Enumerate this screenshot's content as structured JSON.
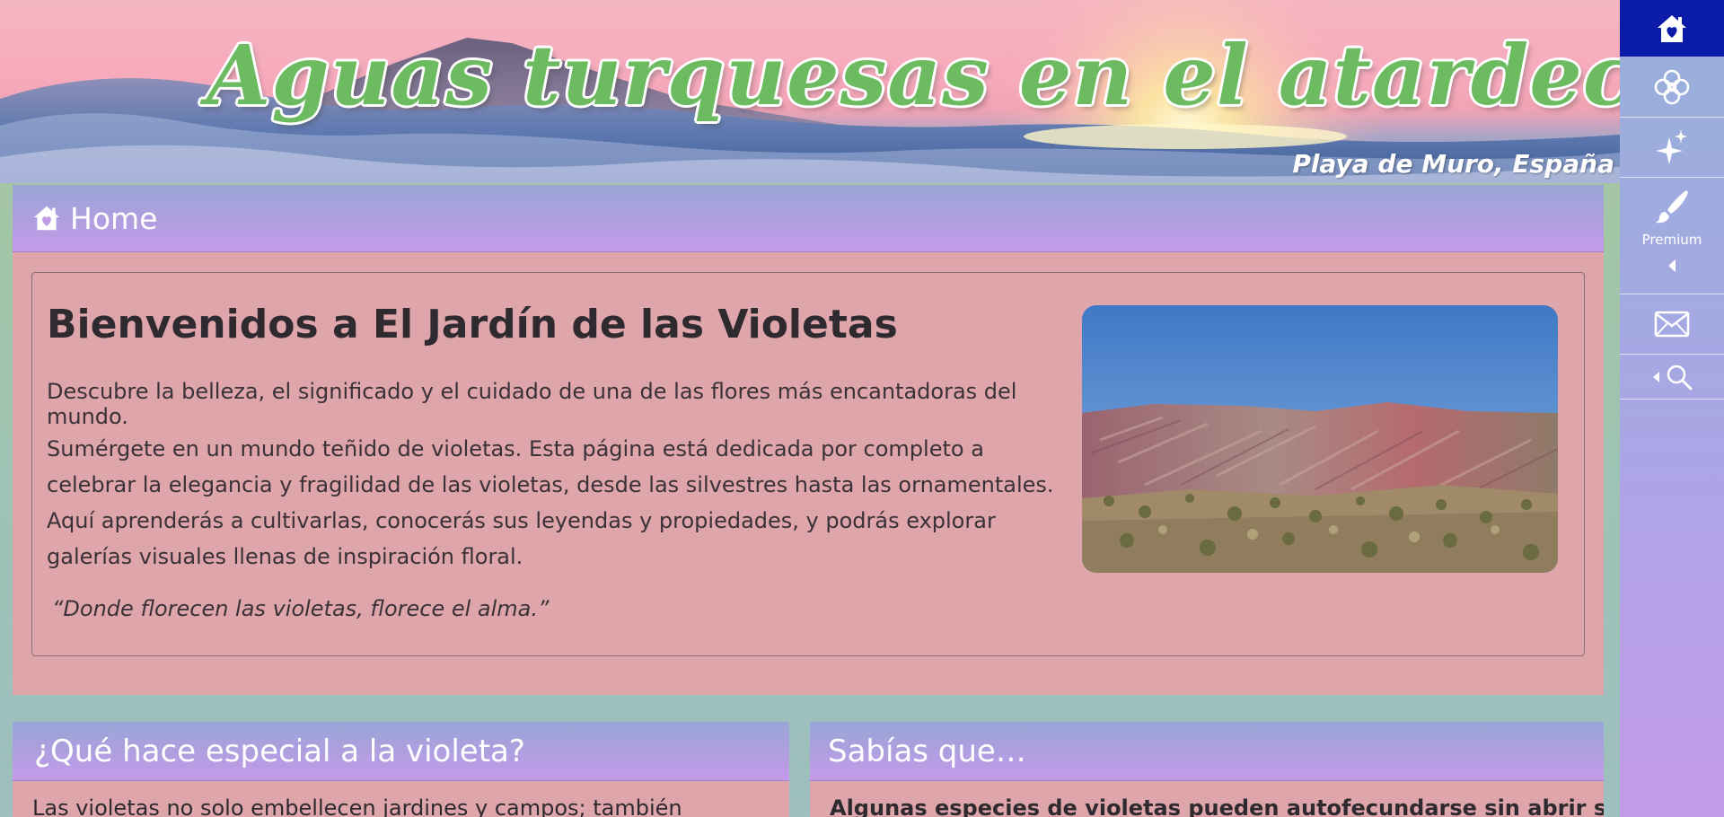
{
  "banner": {
    "title": "Aguas turquesas en el atardecer",
    "subtitle": "Playa de Muro, España"
  },
  "sidebar": {
    "items": [
      {
        "icon": "home-heart-icon",
        "active": true
      },
      {
        "icon": "flower-icon"
      },
      {
        "icon": "sparkles-icon"
      },
      {
        "icon": "brush-icon",
        "label": "Premium"
      },
      {
        "icon": "mail-icon"
      },
      {
        "icon": "search-icon"
      }
    ]
  },
  "main": {
    "breadcrumb": "Home",
    "title": "Bienvenidos a El Jardín de las Violetas",
    "lead": "Descubre la belleza, el significado y el cuidado de una de las flores más encantadoras del mundo.",
    "body": "Sumérgete en un mundo teñido de violetas. Esta página está dedicada por completo a celebrar la elegancia y fragilidad de las violetas, desde las silvestres hasta las ornamentales. Aquí aprenderás a cultivarlas, conocerás sus leyendas y propiedades, y podrás explorar galerías visuales llenas de inspiración floral.",
    "quote": "“Donde florecen las violetas, florece el alma.”"
  },
  "cards": {
    "left": {
      "title": "¿Qué hace especial a la violeta?",
      "body": "Las violetas no solo embellecen jardines y campos; también"
    },
    "right": {
      "title": "Sabías que…",
      "body": "Algunas especies de violetas pueden autofecundarse sin abrir sus"
    }
  },
  "colors": {
    "title_green": "#6cbb60",
    "header_gradient_top": "#97a5d6",
    "header_gradient_bottom": "#c59ae8",
    "panel_pink": "#dea5aa",
    "sidebar_active": "#0a1ca8"
  }
}
